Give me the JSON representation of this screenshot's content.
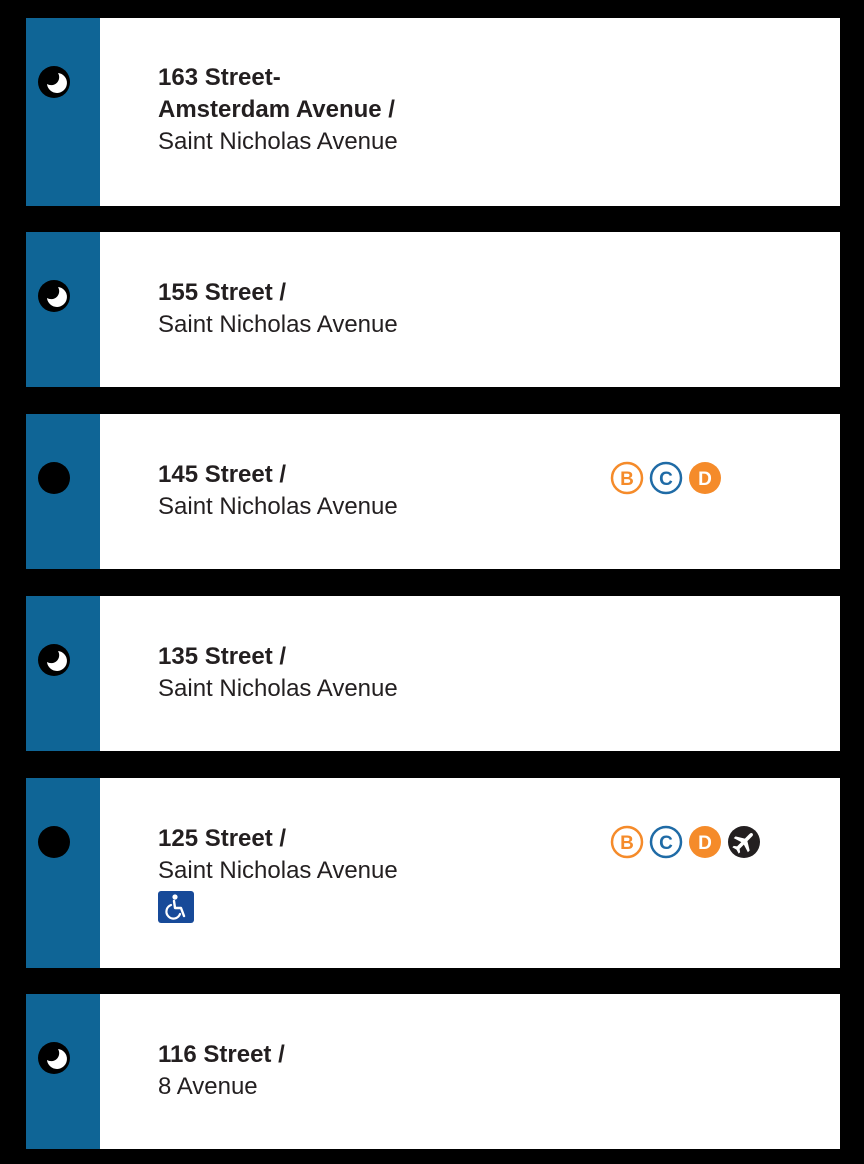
{
  "colors": {
    "line": "#0f6596",
    "orange_route": "#f58b2a",
    "blue_route": "#1f6ba6",
    "text": "#231f20",
    "accessible": "#174a99"
  },
  "stations": [
    {
      "name_lines": [
        "163 Street-",
        "Amsterdam Avenue /"
      ],
      "cross_street": "Saint Nicholas Avenue",
      "service_icon": "part-time-stop-icon",
      "transfers": [],
      "accessible": false
    },
    {
      "name_lines": [
        "155 Street /"
      ],
      "cross_street": "Saint Nicholas Avenue",
      "service_icon": "part-time-stop-icon",
      "transfers": [],
      "accessible": false
    },
    {
      "name_lines": [
        "145 Street /"
      ],
      "cross_street": "Saint Nicholas Avenue",
      "service_icon": "full-time-stop-icon",
      "transfers": [
        {
          "letter": "B",
          "style": "outline-orange"
        },
        {
          "letter": "C",
          "style": "outline-blue"
        },
        {
          "letter": "D",
          "style": "solid-orange"
        }
      ],
      "accessible": false
    },
    {
      "name_lines": [
        "135 Street /"
      ],
      "cross_street": "Saint Nicholas Avenue",
      "service_icon": "part-time-stop-icon",
      "transfers": [],
      "accessible": false
    },
    {
      "name_lines": [
        "125 Street /"
      ],
      "cross_street": "Saint Nicholas Avenue",
      "service_icon": "full-time-stop-icon",
      "transfers": [
        {
          "letter": "B",
          "style": "outline-orange"
        },
        {
          "letter": "C",
          "style": "outline-blue"
        },
        {
          "letter": "D",
          "style": "solid-orange"
        },
        {
          "letter": "",
          "style": "airport-icon"
        }
      ],
      "accessible": true,
      "accessible_icon": "wheelchair-accessible-icon"
    },
    {
      "name_lines": [
        "116 Street /"
      ],
      "cross_street": "8 Avenue",
      "service_icon": "part-time-stop-icon",
      "transfers": [],
      "accessible": false
    }
  ]
}
